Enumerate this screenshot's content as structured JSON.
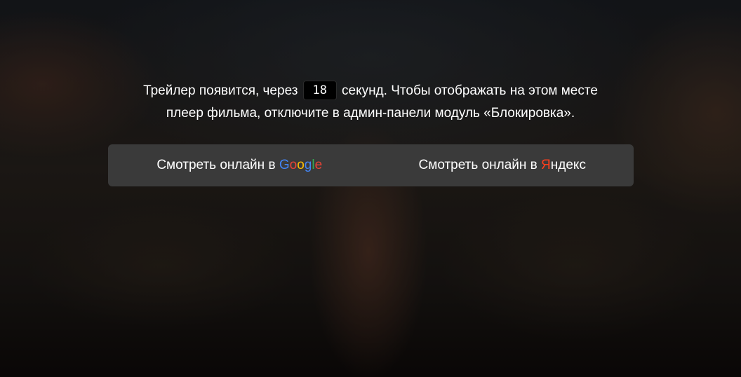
{
  "notice": {
    "prefix": "Трейлер появится, через",
    "countdown": "18",
    "suffix": "секунд. Чтобы отображать на этом месте",
    "line2": "плеер фильма, отключите в админ-панели модуль «Блокировка»."
  },
  "watch_links": {
    "google": {
      "prefix": "Смотреть онлайн в",
      "brand_letters": [
        "G",
        "o",
        "o",
        "g",
        "l",
        "e"
      ],
      "brand_colors": [
        "#4285f4",
        "#ea4335",
        "#fbbc05",
        "#4285f4",
        "#34a853",
        "#ea4335"
      ]
    },
    "yandex": {
      "prefix": "Смотреть онлайн в",
      "brand_first": "Я",
      "brand_rest": "ндекс",
      "brand_color": "#fc3f1d"
    }
  }
}
